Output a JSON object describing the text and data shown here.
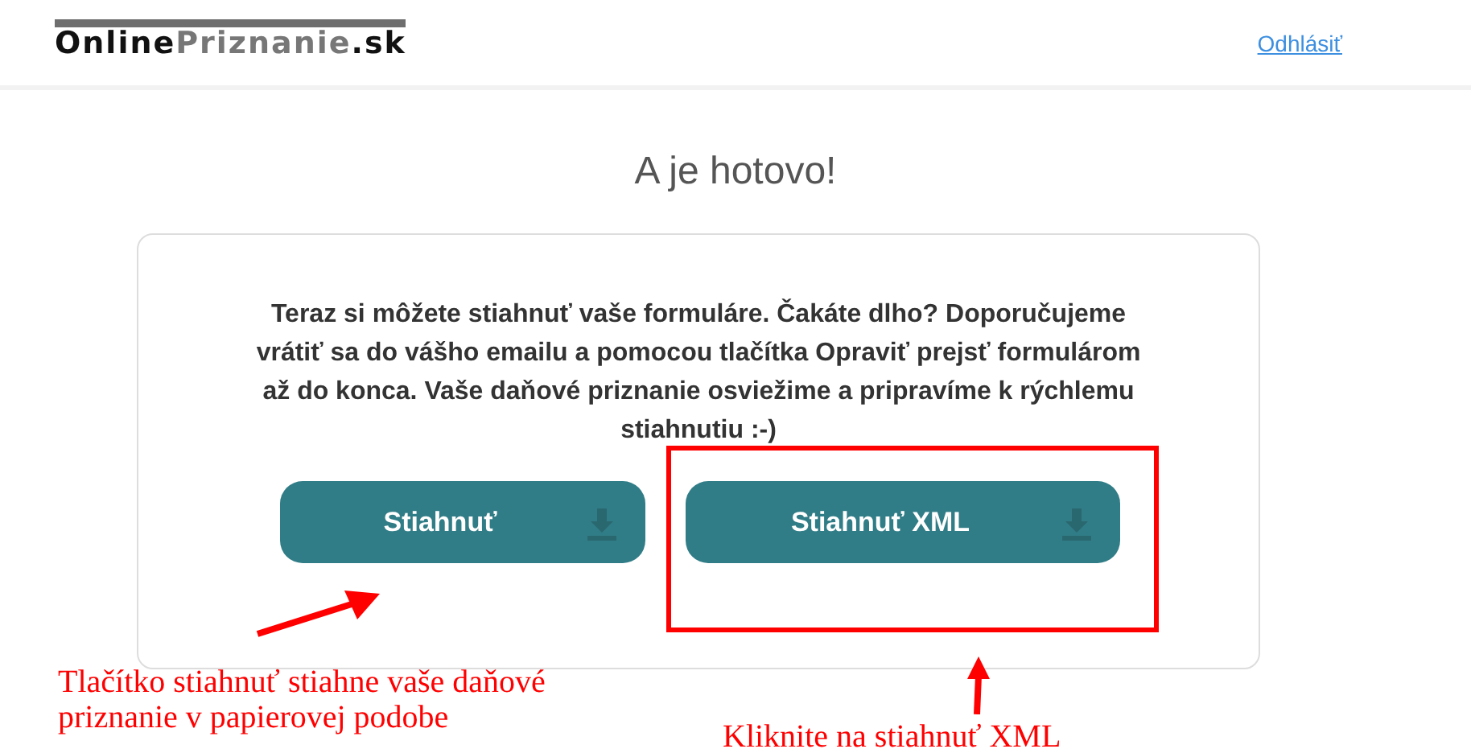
{
  "header": {
    "logo": [
      {
        "text": "Online",
        "kind": "dark"
      },
      {
        "text": "Priznanie",
        "kind": "light"
      },
      {
        "text": ".sk",
        "kind": "dark"
      }
    ],
    "logout_link": "Odhlásiť"
  },
  "title": "A je hotovo!",
  "card": {
    "message": "Teraz si môžete stiahnuť vaše formuláre. Čakáte dlho? Doporučujeme vrátiť sa do vášho emailu a pomocou tlačítka Opraviť prejsť formulárom až do konca. Vaše daňové priznanie osviežime a pripravíme k rýchlemu stiahnutiu :-)",
    "buttons": [
      {
        "label": "Stiahnuť",
        "highlighted": false
      },
      {
        "label": "Stiahnuť XML",
        "highlighted": true
      }
    ]
  },
  "annotations": [
    {
      "text": "Tlačítko stiahnuť stiahne vaše daňové priznanie v papierovej podobe",
      "kind": "left"
    },
    {
      "text": "Kliknite na stiahnuť XML",
      "kind": "right"
    }
  ]
}
